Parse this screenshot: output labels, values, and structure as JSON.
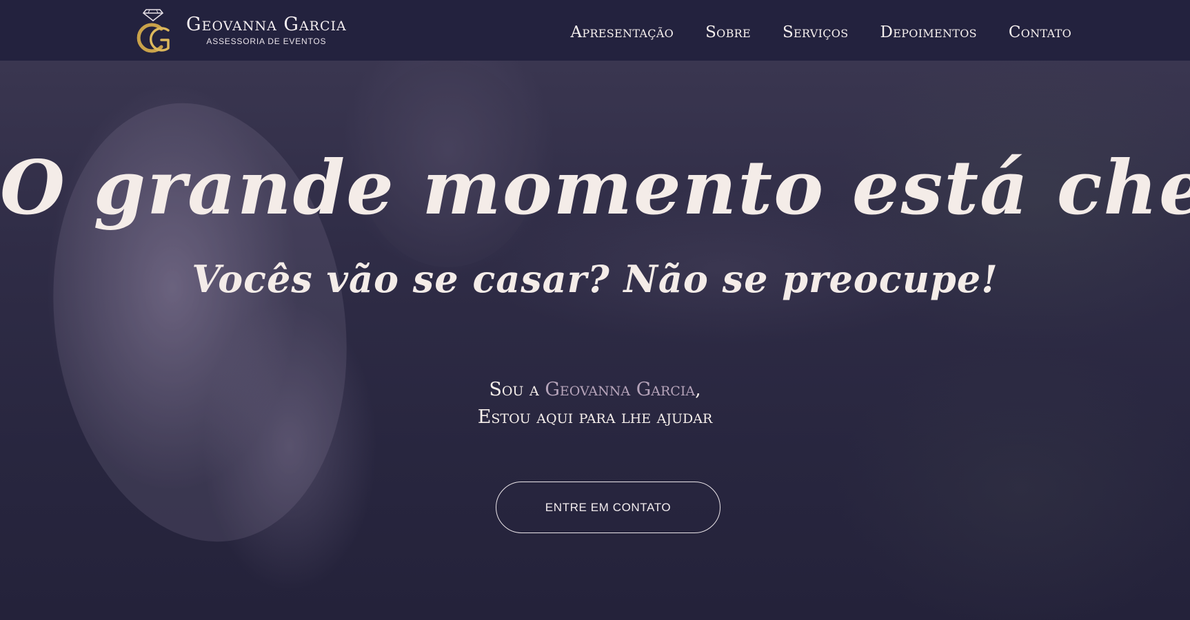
{
  "brand": {
    "name": "Geovanna Garcia",
    "subtitle": "ASSESSORIA DE EVENTOS",
    "logo_icon": "diamond-ring-gg-icon"
  },
  "nav": {
    "items": [
      {
        "label": "Apresentação"
      },
      {
        "label": "Sobre"
      },
      {
        "label": "Serviços"
      },
      {
        "label": "Depoimentos"
      },
      {
        "label": "Contato"
      }
    ]
  },
  "hero": {
    "heading": "O grande momento está chegando?",
    "subheading": "Vocês vão se casar? Não se preocupe!",
    "intro_prefix": "Sou a ",
    "intro_name": "Geovanna Garcia",
    "intro_suffix": ",",
    "intro_line2": "Estou aqui para lhe ajudar",
    "cta_label": "ENTRE EM CONTATO"
  },
  "colors": {
    "header_bg": "#23223e",
    "text": "#f4ece8",
    "accent": "#b6a4ba",
    "logo_gold": "#c9a24a"
  }
}
